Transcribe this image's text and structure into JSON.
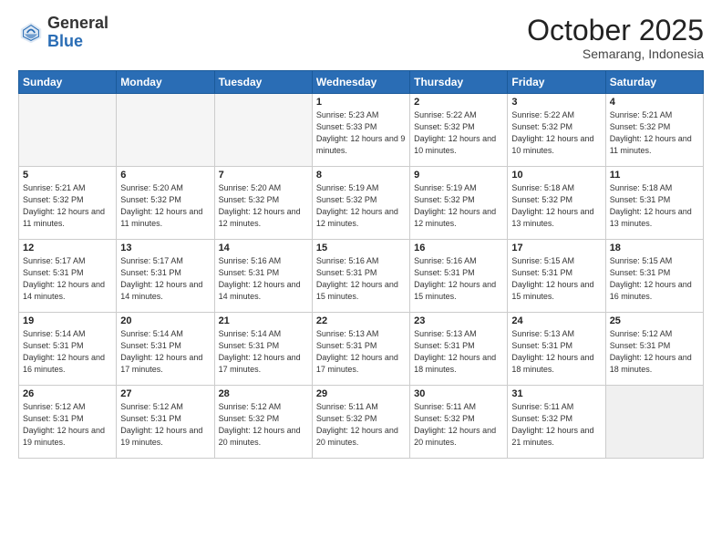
{
  "header": {
    "logo_general": "General",
    "logo_blue": "Blue",
    "month": "October 2025",
    "location": "Semarang, Indonesia"
  },
  "weekdays": [
    "Sunday",
    "Monday",
    "Tuesday",
    "Wednesday",
    "Thursday",
    "Friday",
    "Saturday"
  ],
  "weeks": [
    [
      {
        "day": "",
        "info": ""
      },
      {
        "day": "",
        "info": ""
      },
      {
        "day": "",
        "info": ""
      },
      {
        "day": "1",
        "info": "Sunrise: 5:23 AM\nSunset: 5:33 PM\nDaylight: 12 hours and 9 minutes."
      },
      {
        "day": "2",
        "info": "Sunrise: 5:22 AM\nSunset: 5:32 PM\nDaylight: 12 hours and 10 minutes."
      },
      {
        "day": "3",
        "info": "Sunrise: 5:22 AM\nSunset: 5:32 PM\nDaylight: 12 hours and 10 minutes."
      },
      {
        "day": "4",
        "info": "Sunrise: 5:21 AM\nSunset: 5:32 PM\nDaylight: 12 hours and 11 minutes."
      }
    ],
    [
      {
        "day": "5",
        "info": "Sunrise: 5:21 AM\nSunset: 5:32 PM\nDaylight: 12 hours and 11 minutes."
      },
      {
        "day": "6",
        "info": "Sunrise: 5:20 AM\nSunset: 5:32 PM\nDaylight: 12 hours and 11 minutes."
      },
      {
        "day": "7",
        "info": "Sunrise: 5:20 AM\nSunset: 5:32 PM\nDaylight: 12 hours and 12 minutes."
      },
      {
        "day": "8",
        "info": "Sunrise: 5:19 AM\nSunset: 5:32 PM\nDaylight: 12 hours and 12 minutes."
      },
      {
        "day": "9",
        "info": "Sunrise: 5:19 AM\nSunset: 5:32 PM\nDaylight: 12 hours and 12 minutes."
      },
      {
        "day": "10",
        "info": "Sunrise: 5:18 AM\nSunset: 5:32 PM\nDaylight: 12 hours and 13 minutes."
      },
      {
        "day": "11",
        "info": "Sunrise: 5:18 AM\nSunset: 5:31 PM\nDaylight: 12 hours and 13 minutes."
      }
    ],
    [
      {
        "day": "12",
        "info": "Sunrise: 5:17 AM\nSunset: 5:31 PM\nDaylight: 12 hours and 14 minutes."
      },
      {
        "day": "13",
        "info": "Sunrise: 5:17 AM\nSunset: 5:31 PM\nDaylight: 12 hours and 14 minutes."
      },
      {
        "day": "14",
        "info": "Sunrise: 5:16 AM\nSunset: 5:31 PM\nDaylight: 12 hours and 14 minutes."
      },
      {
        "day": "15",
        "info": "Sunrise: 5:16 AM\nSunset: 5:31 PM\nDaylight: 12 hours and 15 minutes."
      },
      {
        "day": "16",
        "info": "Sunrise: 5:16 AM\nSunset: 5:31 PM\nDaylight: 12 hours and 15 minutes."
      },
      {
        "day": "17",
        "info": "Sunrise: 5:15 AM\nSunset: 5:31 PM\nDaylight: 12 hours and 15 minutes."
      },
      {
        "day": "18",
        "info": "Sunrise: 5:15 AM\nSunset: 5:31 PM\nDaylight: 12 hours and 16 minutes."
      }
    ],
    [
      {
        "day": "19",
        "info": "Sunrise: 5:14 AM\nSunset: 5:31 PM\nDaylight: 12 hours and 16 minutes."
      },
      {
        "day": "20",
        "info": "Sunrise: 5:14 AM\nSunset: 5:31 PM\nDaylight: 12 hours and 17 minutes."
      },
      {
        "day": "21",
        "info": "Sunrise: 5:14 AM\nSunset: 5:31 PM\nDaylight: 12 hours and 17 minutes."
      },
      {
        "day": "22",
        "info": "Sunrise: 5:13 AM\nSunset: 5:31 PM\nDaylight: 12 hours and 17 minutes."
      },
      {
        "day": "23",
        "info": "Sunrise: 5:13 AM\nSunset: 5:31 PM\nDaylight: 12 hours and 18 minutes."
      },
      {
        "day": "24",
        "info": "Sunrise: 5:13 AM\nSunset: 5:31 PM\nDaylight: 12 hours and 18 minutes."
      },
      {
        "day": "25",
        "info": "Sunrise: 5:12 AM\nSunset: 5:31 PM\nDaylight: 12 hours and 18 minutes."
      }
    ],
    [
      {
        "day": "26",
        "info": "Sunrise: 5:12 AM\nSunset: 5:31 PM\nDaylight: 12 hours and 19 minutes."
      },
      {
        "day": "27",
        "info": "Sunrise: 5:12 AM\nSunset: 5:31 PM\nDaylight: 12 hours and 19 minutes."
      },
      {
        "day": "28",
        "info": "Sunrise: 5:12 AM\nSunset: 5:32 PM\nDaylight: 12 hours and 20 minutes."
      },
      {
        "day": "29",
        "info": "Sunrise: 5:11 AM\nSunset: 5:32 PM\nDaylight: 12 hours and 20 minutes."
      },
      {
        "day": "30",
        "info": "Sunrise: 5:11 AM\nSunset: 5:32 PM\nDaylight: 12 hours and 20 minutes."
      },
      {
        "day": "31",
        "info": "Sunrise: 5:11 AM\nSunset: 5:32 PM\nDaylight: 12 hours and 21 minutes."
      },
      {
        "day": "",
        "info": ""
      }
    ]
  ]
}
